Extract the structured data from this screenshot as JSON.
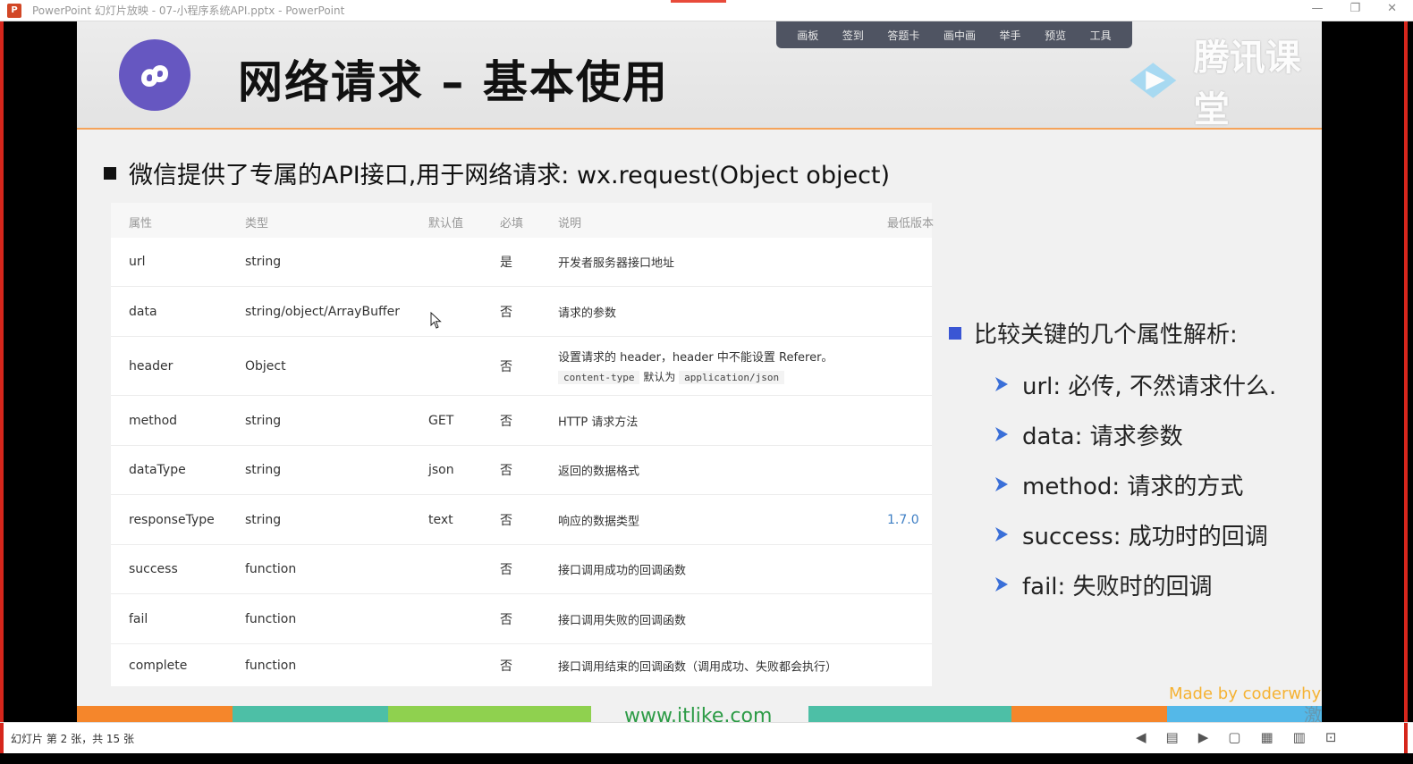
{
  "window": {
    "app_icon": "P",
    "title": "PowerPoint 幻灯片放映 - 07-小程序系统API.pptx - PowerPoint"
  },
  "toolbar": [
    "画板",
    "签到",
    "答题卡",
    "画中画",
    "举手",
    "预览",
    "工具"
  ],
  "watermark": {
    "brand": "腾讯课堂"
  },
  "slide": {
    "title": "网络请求 – 基本使用",
    "bullet": "微信提供了专属的API接口,用于网络请求: wx.request(Object object)",
    "table": {
      "headers": [
        "属性",
        "类型",
        "默认值",
        "必填",
        "说明",
        "最低版本"
      ],
      "rows": [
        {
          "attr": "url",
          "type": "string",
          "default": "",
          "required": "是",
          "desc": "开发者服务器接口地址",
          "version": ""
        },
        {
          "attr": "data",
          "type": "string/object/ArrayBuffer",
          "default": "",
          "required": "否",
          "desc": "请求的参数",
          "version": ""
        },
        {
          "attr": "header",
          "type": "Object",
          "default": "",
          "required": "否",
          "desc": "设置请求的 header，header 中不能设置 Referer。",
          "version": ""
        },
        {
          "attr": "method",
          "type": "string",
          "default": "GET",
          "required": "否",
          "desc": "HTTP 请求方法",
          "version": ""
        },
        {
          "attr": "dataType",
          "type": "string",
          "default": "json",
          "required": "否",
          "desc": "返回的数据格式",
          "version": ""
        },
        {
          "attr": "responseType",
          "type": "string",
          "default": "text",
          "required": "否",
          "desc": "响应的数据类型",
          "version": "1.7.0"
        },
        {
          "attr": "success",
          "type": "function",
          "default": "",
          "required": "否",
          "desc": "接口调用成功的回调函数",
          "version": ""
        },
        {
          "attr": "fail",
          "type": "function",
          "default": "",
          "required": "否",
          "desc": "接口调用失败的回调函数",
          "version": ""
        },
        {
          "attr": "complete",
          "type": "function",
          "default": "",
          "required": "否",
          "desc": "接口调用结束的回调函数（调用成功、失败都会执行）",
          "version": ""
        }
      ],
      "header_desc_line2": {
        "code1": "content-type",
        "middle": "默认为",
        "code2": "application/json"
      }
    },
    "side_heading": "比较关键的几个属性解析:",
    "side_items": [
      "url: 必传, 不然请求什么.",
      "data: 请求参数",
      "method: 请求的方式",
      "success: 成功时的回调",
      "fail: 失败时的回调"
    ],
    "made_by": "Made by coderwhy",
    "site": "www.itlike.com"
  },
  "os_watermark": "激活 Windows",
  "status": {
    "slide_counter": "幻灯片 第 2 张，共 15 张"
  },
  "colors": {
    "accent_orange": "#f5a35a",
    "logo_purple": "#6657c1",
    "side_bullet_blue": "#3a56d4",
    "version_blue": "#3d7ec4",
    "made_by_yellow": "#f5b233",
    "site_green": "#2c9b46"
  }
}
